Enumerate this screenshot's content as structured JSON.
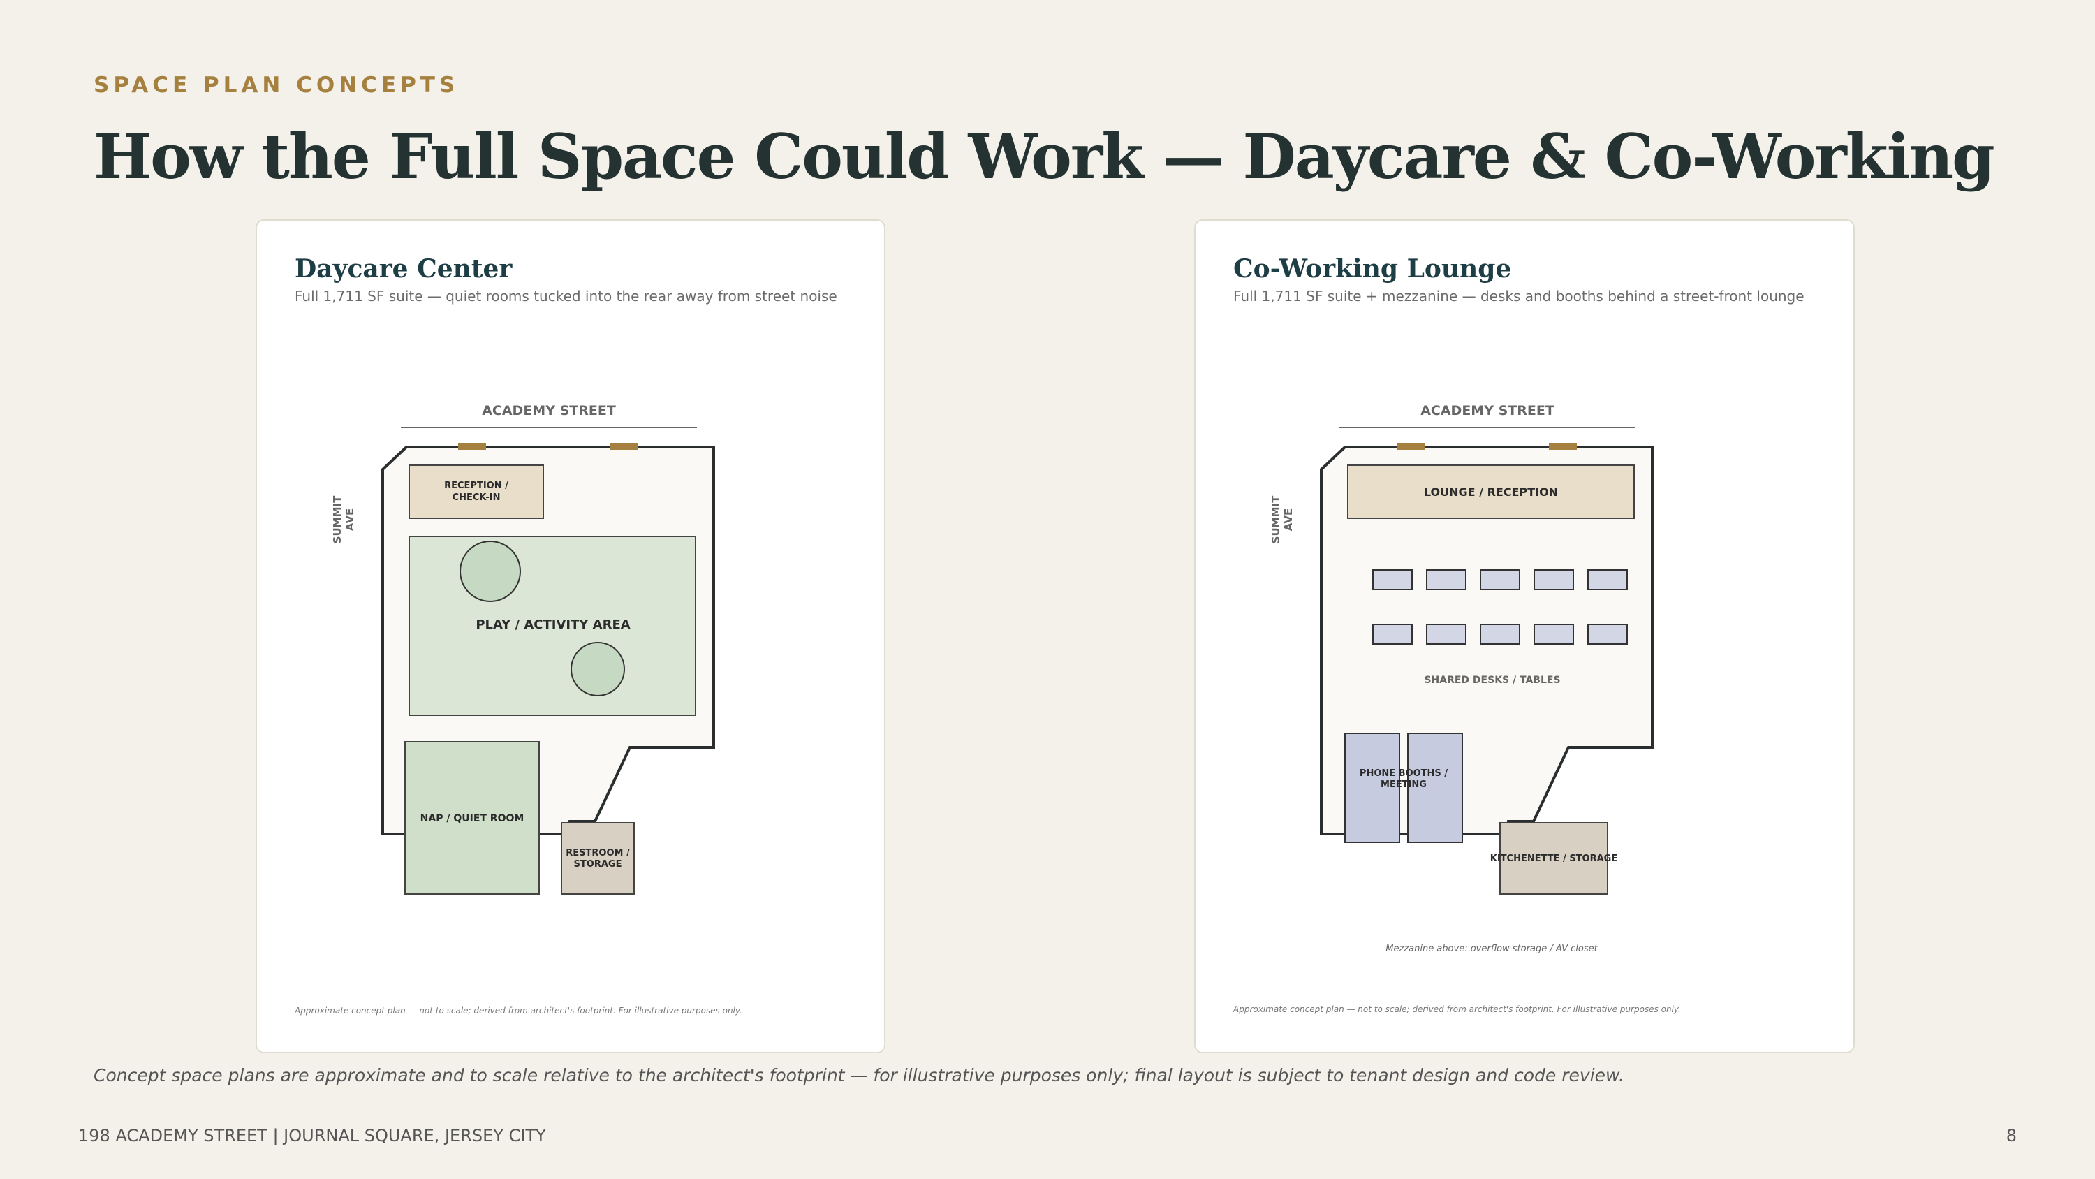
{
  "eyebrow": "SPACE PLAN CONCEPTS",
  "title": "How the Full Space Could Work — Daycare & Co-Working",
  "daycare": {
    "title": "Daycare Center",
    "subtitle": "Full 1,711 SF suite — quiet rooms tucked into the rear away from street noise",
    "street_top": "ACADEMY STREET",
    "street_side_1": "SUMMIT",
    "street_side_2": "AVE",
    "rooms": {
      "reception_1": "RECEPTION /",
      "reception_2": "CHECK-IN",
      "play": "PLAY / ACTIVITY AREA",
      "nap": "NAP / QUIET ROOM",
      "restroom_1": "RESTROOM /",
      "restroom_2": "STORAGE"
    },
    "disclaimer": "Approximate concept plan — not to scale; derived from architect's footprint. For illustrative purposes only."
  },
  "coworking": {
    "title": "Co-Working Lounge",
    "subtitle": "Full 1,711 SF suite + mezzanine — desks and booths behind a street-front lounge",
    "street_top": "ACADEMY STREET",
    "street_side_1": "SUMMIT",
    "street_side_2": "AVE",
    "rooms": {
      "lounge": "LOUNGE / RECEPTION",
      "desks": "SHARED DESKS / TABLES",
      "booths_1": "PHONE BOOTHS /",
      "booths_2": "MEETING",
      "kitchen": "KITCHENETTE / STORAGE"
    },
    "mezzanine_note": "Mezzanine above: overflow storage / AV closet",
    "disclaimer": "Approximate concept plan — not to scale; derived from architect's footprint. For illustrative purposes only."
  },
  "caption": "Concept space plans are approximate and to scale relative to the architect's footprint — for illustrative purposes only; final layout is subject to tenant design and code review.",
  "footer": {
    "address": "198 ACADEMY STREET  |  JOURNAL SQUARE, JERSEY CITY",
    "page_number": "8"
  },
  "colors": {
    "accent": "#a5803f",
    "title": "#243232",
    "play_green": "#dce6d6",
    "nap_green": "#cfdfc9",
    "tan": "#e8dec9",
    "desk_blue": "#d3d6e4",
    "booth_blue": "#c6cbdf",
    "storage": "#d8d0c3"
  }
}
